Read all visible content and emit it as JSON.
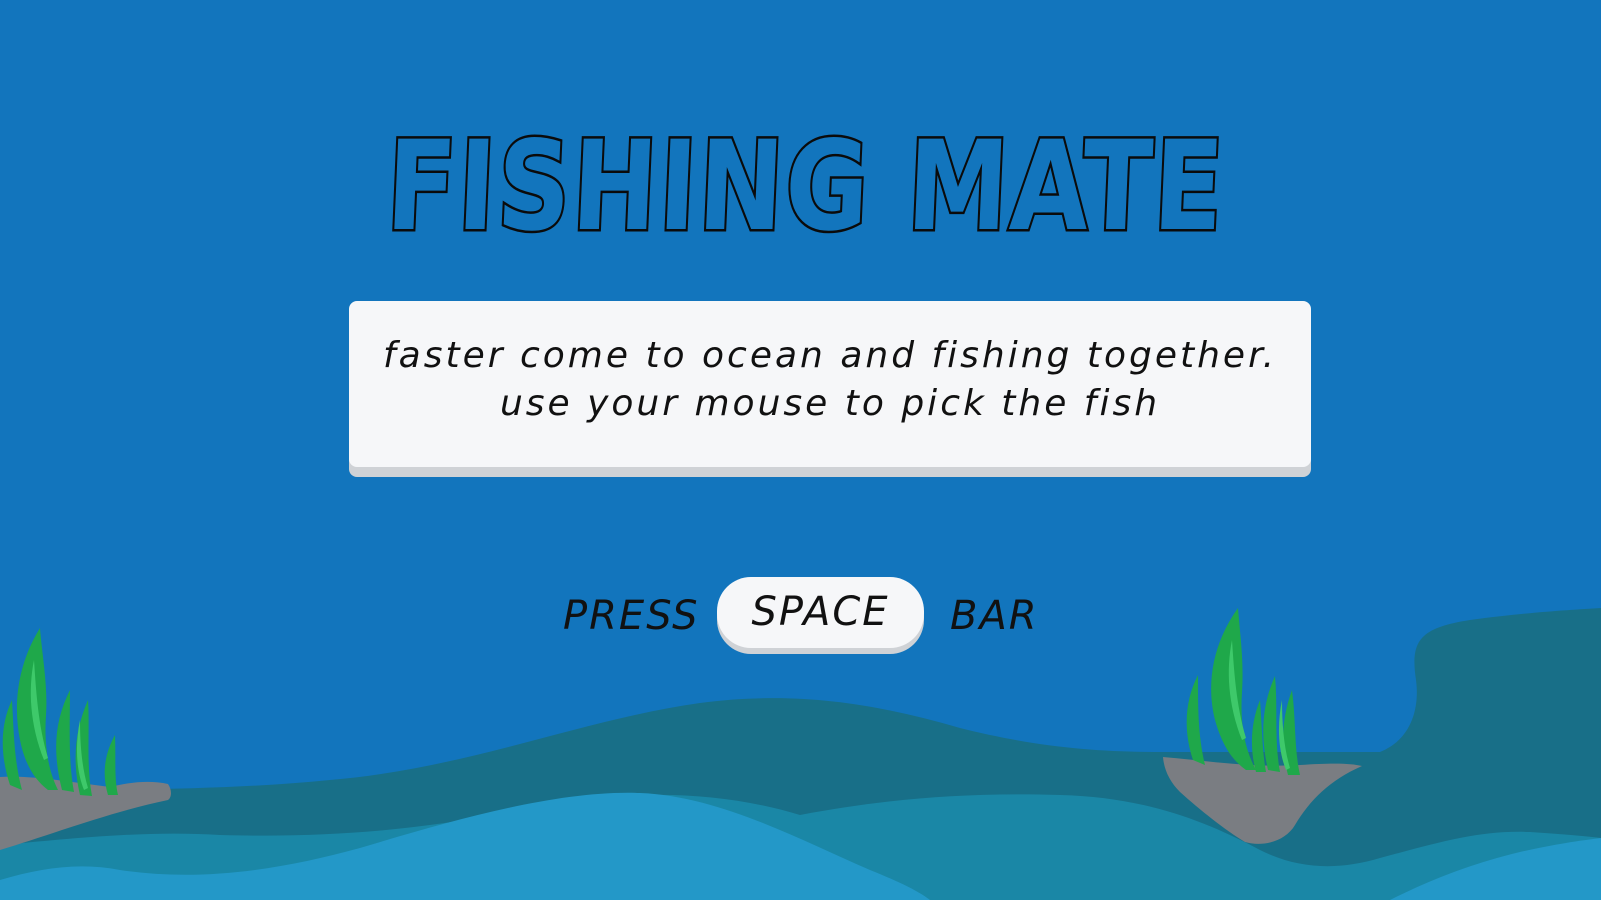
{
  "game": {
    "title": "FISHING MATE",
    "instructions": {
      "line1": "faster come to ocean and fishing together.",
      "line2": "use your mouse to pick the fish"
    },
    "prompt": {
      "before": "PRESS",
      "key": "SPACE",
      "after": "BAR"
    }
  },
  "palette": {
    "sky": "#1275bd",
    "far_wave": "#186f88",
    "mid_wave": "#1a87a6",
    "near_wave": "#2398c8",
    "rock": "#7a7d82",
    "seaweed_dark": "#1fa84a",
    "seaweed_light": "#3ec96a",
    "panel": "#f6f7f9",
    "panel_shadow": "#cfd2d6",
    "text": "#111111"
  }
}
